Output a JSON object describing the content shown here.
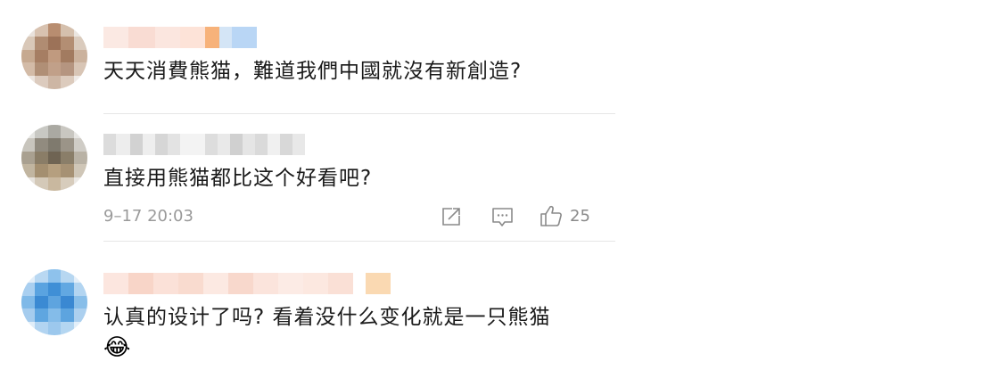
{
  "comments": [
    {
      "text": "天天消費熊猫，難道我們中國就沒有新創造?"
    },
    {
      "text": "直接用熊猫都比这个好看吧?",
      "time": "9–17 20:03",
      "like_count": "25",
      "icons": [
        "share-icon",
        "comment-icon",
        "like-icon"
      ]
    },
    {
      "text": "认真的设计了吗? 看着没什么变化就是一只熊猫",
      "emoji": "😂"
    }
  ]
}
